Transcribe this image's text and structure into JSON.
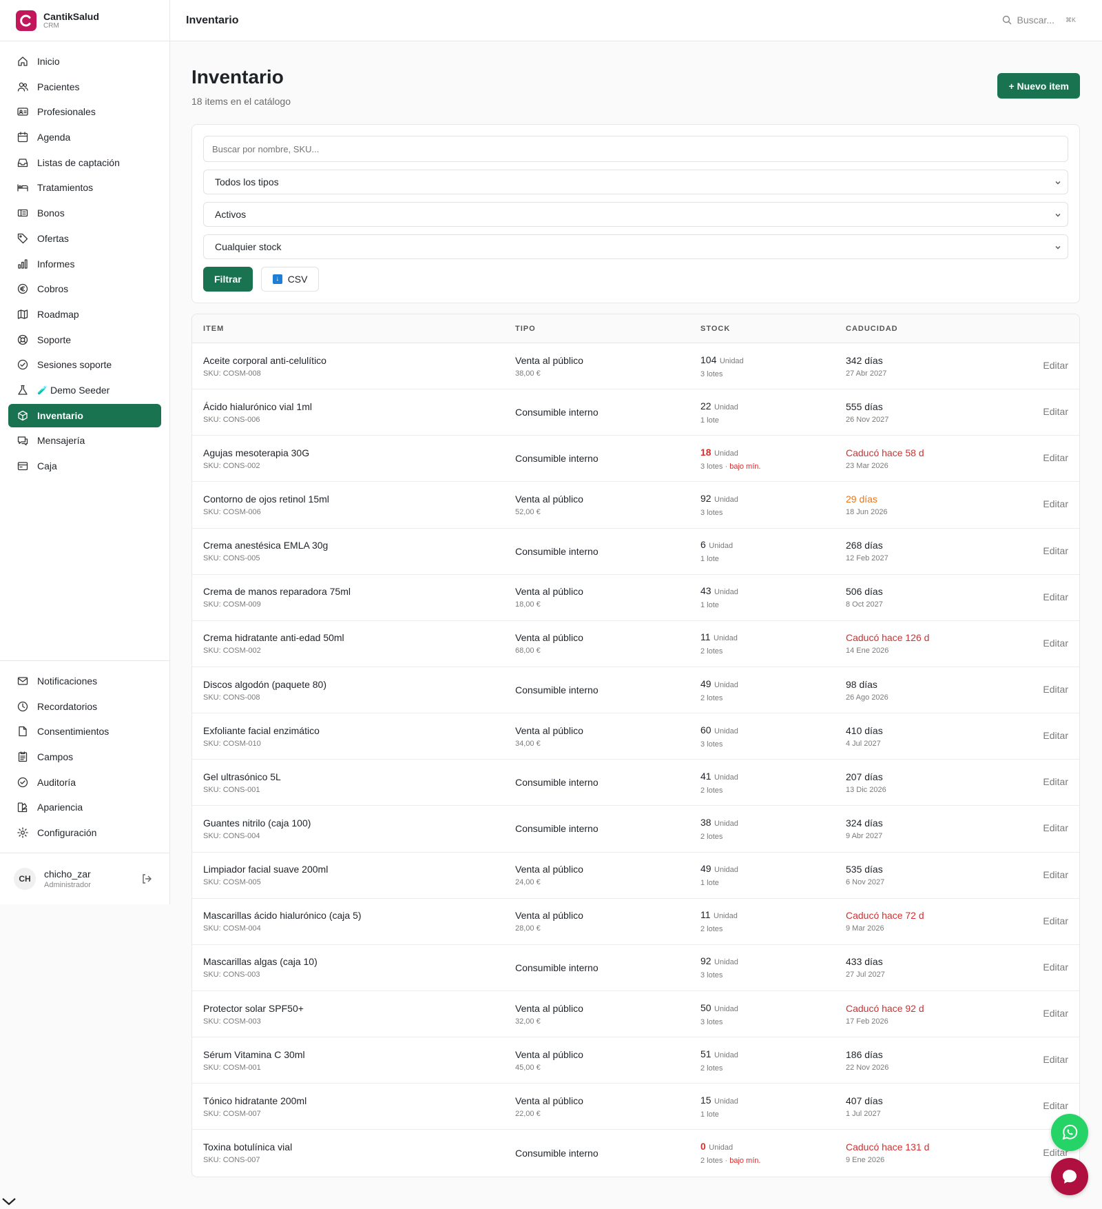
{
  "brand": {
    "name": "CantikSalud",
    "sub": "CRM",
    "color": "#c2185b"
  },
  "topbar": {
    "title": "Inventario",
    "search_placeholder": "Buscar...",
    "shortcut": "⌘K"
  },
  "sidebar": {
    "items": [
      {
        "label": "Inicio",
        "icon": "home-icon"
      },
      {
        "label": "Pacientes",
        "icon": "users-icon"
      },
      {
        "label": "Profesionales",
        "icon": "id-card-icon"
      },
      {
        "label": "Agenda",
        "icon": "calendar-icon"
      },
      {
        "label": "Listas de captación",
        "icon": "inbox-icon"
      },
      {
        "label": "Tratamientos",
        "icon": "bed-icon"
      },
      {
        "label": "Bonos",
        "icon": "ticket-icon"
      },
      {
        "label": "Ofertas",
        "icon": "tag-icon"
      },
      {
        "label": "Informes",
        "icon": "bar-chart-icon"
      },
      {
        "label": "Cobros",
        "icon": "euro-icon"
      },
      {
        "label": "Roadmap",
        "icon": "map-icon"
      },
      {
        "label": "Soporte",
        "icon": "lifebuoy-icon"
      },
      {
        "label": "Sesiones soporte",
        "icon": "check-circle-icon"
      },
      {
        "label": "Demo Seeder",
        "icon": "flask-icon",
        "prefix": "🧪"
      },
      {
        "label": "Inventario",
        "icon": "box-icon",
        "active": true
      },
      {
        "label": "Mensajería",
        "icon": "chat-icon"
      },
      {
        "label": "Caja",
        "icon": "register-icon"
      }
    ],
    "bottom_items": [
      {
        "label": "Notificaciones",
        "icon": "mail-icon"
      },
      {
        "label": "Recordatorios",
        "icon": "clock-icon"
      },
      {
        "label": "Consentimientos",
        "icon": "file-icon"
      },
      {
        "label": "Campos",
        "icon": "form-icon"
      },
      {
        "label": "Auditoría",
        "icon": "shield-check-icon"
      },
      {
        "label": "Apariencia",
        "icon": "palette-icon"
      },
      {
        "label": "Configuración",
        "icon": "gear-icon"
      }
    ],
    "user": {
      "initials": "CH",
      "name": "chicho_zar",
      "role": "Administrador"
    }
  },
  "page": {
    "title": "Inventario",
    "subtitle": "18 items en el catálogo",
    "new_button": "+ Nuevo item"
  },
  "filters": {
    "search_placeholder": "Buscar por nombre, SKU...",
    "type": "Todos los tipos",
    "status": "Activos",
    "stock": "Cualquier stock",
    "filter_button": "Filtrar",
    "csv_button": "CSV"
  },
  "table": {
    "headers": [
      "ITEM",
      "TIPO",
      "STOCK",
      "CADUCIDAD"
    ],
    "edit_label": "Editar",
    "rows": [
      {
        "name": "Aceite corporal anti-celulítico",
        "sku": "SKU: COSM-008",
        "type": "Venta al público",
        "price": "38,00 €",
        "stock": "104",
        "unit": "Unidad",
        "lots": "3 lotes",
        "low": false,
        "exp": "342 días",
        "exp_date": "27 Abr 2027",
        "exp_status": "ok"
      },
      {
        "name": "Ácido hialurónico vial 1ml",
        "sku": "SKU: CONS-006",
        "type": "Consumible interno",
        "price": "",
        "stock": "22",
        "unit": "Unidad",
        "lots": "1 lote",
        "low": false,
        "exp": "555 días",
        "exp_date": "26 Nov 2027",
        "exp_status": "ok"
      },
      {
        "name": "Agujas mesoterapia 30G",
        "sku": "SKU: CONS-002",
        "type": "Consumible interno",
        "price": "",
        "stock": "18",
        "unit": "Unidad",
        "lots": "3 lotes",
        "low": true,
        "exp": "Caducó hace 58 d",
        "exp_date": "23 Mar 2026",
        "exp_status": "expired"
      },
      {
        "name": "Contorno de ojos retinol 15ml",
        "sku": "SKU: COSM-006",
        "type": "Venta al público",
        "price": "52,00 €",
        "stock": "92",
        "unit": "Unidad",
        "lots": "3 lotes",
        "low": false,
        "exp": "29 días",
        "exp_date": "18 Jun 2026",
        "exp_status": "soon"
      },
      {
        "name": "Crema anestésica EMLA 30g",
        "sku": "SKU: CONS-005",
        "type": "Consumible interno",
        "price": "",
        "stock": "6",
        "unit": "Unidad",
        "lots": "1 lote",
        "low": false,
        "exp": "268 días",
        "exp_date": "12 Feb 2027",
        "exp_status": "ok"
      },
      {
        "name": "Crema de manos reparadora 75ml",
        "sku": "SKU: COSM-009",
        "type": "Venta al público",
        "price": "18,00 €",
        "stock": "43",
        "unit": "Unidad",
        "lots": "1 lote",
        "low": false,
        "exp": "506 días",
        "exp_date": "8 Oct 2027",
        "exp_status": "ok"
      },
      {
        "name": "Crema hidratante anti-edad 50ml",
        "sku": "SKU: COSM-002",
        "type": "Venta al público",
        "price": "68,00 €",
        "stock": "11",
        "unit": "Unidad",
        "lots": "2 lotes",
        "low": false,
        "exp": "Caducó hace 126 d",
        "exp_date": "14 Ene 2026",
        "exp_status": "expired"
      },
      {
        "name": "Discos algodón (paquete 80)",
        "sku": "SKU: CONS-008",
        "type": "Consumible interno",
        "price": "",
        "stock": "49",
        "unit": "Unidad",
        "lots": "2 lotes",
        "low": false,
        "exp": "98 días",
        "exp_date": "26 Ago 2026",
        "exp_status": "ok"
      },
      {
        "name": "Exfoliante facial enzimático",
        "sku": "SKU: COSM-010",
        "type": "Venta al público",
        "price": "34,00 €",
        "stock": "60",
        "unit": "Unidad",
        "lots": "3 lotes",
        "low": false,
        "exp": "410 días",
        "exp_date": "4 Jul 2027",
        "exp_status": "ok"
      },
      {
        "name": "Gel ultrasónico 5L",
        "sku": "SKU: CONS-001",
        "type": "Consumible interno",
        "price": "",
        "stock": "41",
        "unit": "Unidad",
        "lots": "2 lotes",
        "low": false,
        "exp": "207 días",
        "exp_date": "13 Dic 2026",
        "exp_status": "ok"
      },
      {
        "name": "Guantes nitrilo (caja 100)",
        "sku": "SKU: CONS-004",
        "type": "Consumible interno",
        "price": "",
        "stock": "38",
        "unit": "Unidad",
        "lots": "2 lotes",
        "low": false,
        "exp": "324 días",
        "exp_date": "9 Abr 2027",
        "exp_status": "ok"
      },
      {
        "name": "Limpiador facial suave 200ml",
        "sku": "SKU: COSM-005",
        "type": "Venta al público",
        "price": "24,00 €",
        "stock": "49",
        "unit": "Unidad",
        "lots": "1 lote",
        "low": false,
        "exp": "535 días",
        "exp_date": "6 Nov 2027",
        "exp_status": "ok"
      },
      {
        "name": "Mascarillas ácido hialurónico (caja 5)",
        "sku": "SKU: COSM-004",
        "type": "Venta al público",
        "price": "28,00 €",
        "stock": "11",
        "unit": "Unidad",
        "lots": "2 lotes",
        "low": false,
        "exp": "Caducó hace 72 d",
        "exp_date": "9 Mar 2026",
        "exp_status": "expired"
      },
      {
        "name": "Mascarillas algas (caja 10)",
        "sku": "SKU: CONS-003",
        "type": "Consumible interno",
        "price": "",
        "stock": "92",
        "unit": "Unidad",
        "lots": "3 lotes",
        "low": false,
        "exp": "433 días",
        "exp_date": "27 Jul 2027",
        "exp_status": "ok"
      },
      {
        "name": "Protector solar SPF50+",
        "sku": "SKU: COSM-003",
        "type": "Venta al público",
        "price": "32,00 €",
        "stock": "50",
        "unit": "Unidad",
        "lots": "3 lotes",
        "low": false,
        "exp": "Caducó hace 92 d",
        "exp_date": "17 Feb 2026",
        "exp_status": "expired"
      },
      {
        "name": "Sérum Vitamina C 30ml",
        "sku": "SKU: COSM-001",
        "type": "Venta al público",
        "price": "45,00 €",
        "stock": "51",
        "unit": "Unidad",
        "lots": "2 lotes",
        "low": false,
        "exp": "186 días",
        "exp_date": "22 Nov 2026",
        "exp_status": "ok"
      },
      {
        "name": "Tónico hidratante 200ml",
        "sku": "SKU: COSM-007",
        "type": "Venta al público",
        "price": "22,00 €",
        "stock": "15",
        "unit": "Unidad",
        "lots": "1 lote",
        "low": false,
        "exp": "407 días",
        "exp_date": "1 Jul 2027",
        "exp_status": "ok"
      },
      {
        "name": "Toxina botulínica vial",
        "sku": "SKU: CONS-007",
        "type": "Consumible interno",
        "price": "",
        "stock": "0",
        "unit": "Unidad",
        "lots": "2 lotes",
        "low": true,
        "exp": "Caducó hace 131 d",
        "exp_date": "9 Ene 2026",
        "exp_status": "expired"
      }
    ],
    "low_label": "bajo mín."
  },
  "colors": {
    "accent": "#1a7350",
    "danger": "#d32f2f",
    "warning": "#e8761b",
    "whatsapp": "#25d366",
    "chat": "#b0103f"
  }
}
